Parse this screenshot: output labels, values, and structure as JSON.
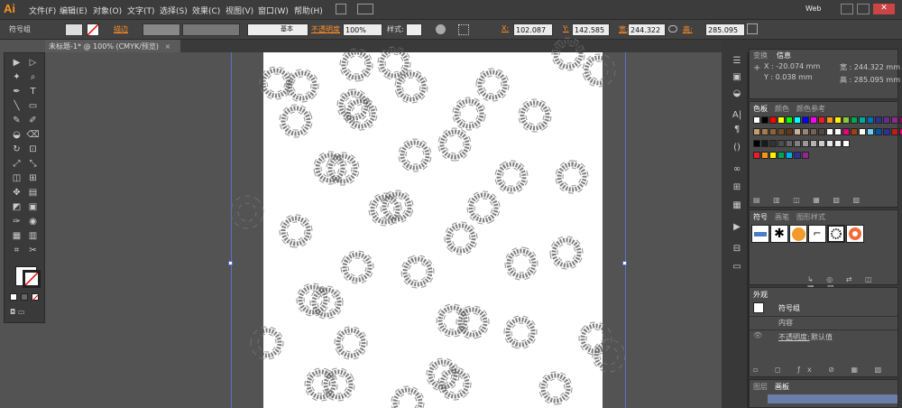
{
  "app": {
    "logo": "Ai",
    "workspace": "Web"
  },
  "menu": [
    "文件(F)",
    "编辑(E)",
    "对象(O)",
    "文字(T)",
    "选择(S)",
    "效果(C)",
    "视图(V)",
    "窗口(W)",
    "帮助(H)"
  ],
  "control": {
    "selection_label": "符号组",
    "stroke_label": "描边",
    "stroke_style": "基本",
    "opacity_label": "不透明度",
    "opacity_value": "100%",
    "style_label": "样式:",
    "x_label": "X:",
    "x_value": "102.087",
    "y_label": "Y:",
    "y_value": "142.585",
    "w_label": "宽:",
    "w_value": "244.322",
    "h_label": "高:",
    "h_value": "285.095"
  },
  "document_tab": "未标题-1* @ 100% (CMYK/预览)",
  "panels": {
    "transform": {
      "tabs": [
        "变换",
        "信息"
      ],
      "x": "X : -20.074 mm",
      "y": "Y : 0.038 mm",
      "w": "宽 : 244.322 mm",
      "h": "高 : 285.095 mm"
    },
    "swatches": {
      "tabs": [
        "色板",
        "颜色",
        "颜色参考"
      ]
    },
    "symbols": {
      "tabs": [
        "符号",
        "画笔",
        "图形样式"
      ]
    },
    "appearance": {
      "title": "外观",
      "rows": [
        "符号组",
        "内容"
      ],
      "opacity_label": "不透明度:",
      "opacity_value": "默认值"
    },
    "layers": {
      "tabs": [
        "图层",
        "画板"
      ]
    }
  },
  "colors": {
    "swatch_row1": [
      "#ffffff",
      "#000000",
      "#ff0000",
      "#ffff00",
      "#00ff00",
      "#00ffff",
      "#0000ff",
      "#ff00ff",
      "#ed1c24",
      "#f7941d",
      "#fff200",
      "#8dc63f",
      "#00a651",
      "#00a99d",
      "#0072bc",
      "#2e3192",
      "#662d91",
      "#92278f",
      "#9e005d",
      "#ed145b",
      "#f26522",
      "#f7941d",
      "#ffc20e",
      "#a3d55d"
    ],
    "swatch_row2": [
      "#c69c6d",
      "#a67c52",
      "#8c6239",
      "#754c24",
      "#603913",
      "#c7b299",
      "#998675",
      "#736357",
      "#534741",
      "#ffffff",
      "#ffffff",
      "#e6007e",
      "#a0410d",
      "#ffffff",
      "#6dcff6",
      "#0054a6",
      "#2e3192",
      "#bd1b21",
      "#e6007e",
      "#9e005d",
      "#ffffff",
      "#c8c8c8"
    ],
    "swatch_row3": [
      "#000000",
      "#1a1a1a",
      "#333333",
      "#4d4d4d",
      "#666666",
      "#808080",
      "#999999",
      "#b3b3b3",
      "#cccccc",
      "#e6e6e6",
      "#f2f2f2",
      "#ffffff"
    ],
    "swatch_row4": [
      "#ed1c24",
      "#f7941d",
      "#fff200",
      "#00a651",
      "#00aeef",
      "#2e3192",
      "#92278f"
    ]
  }
}
